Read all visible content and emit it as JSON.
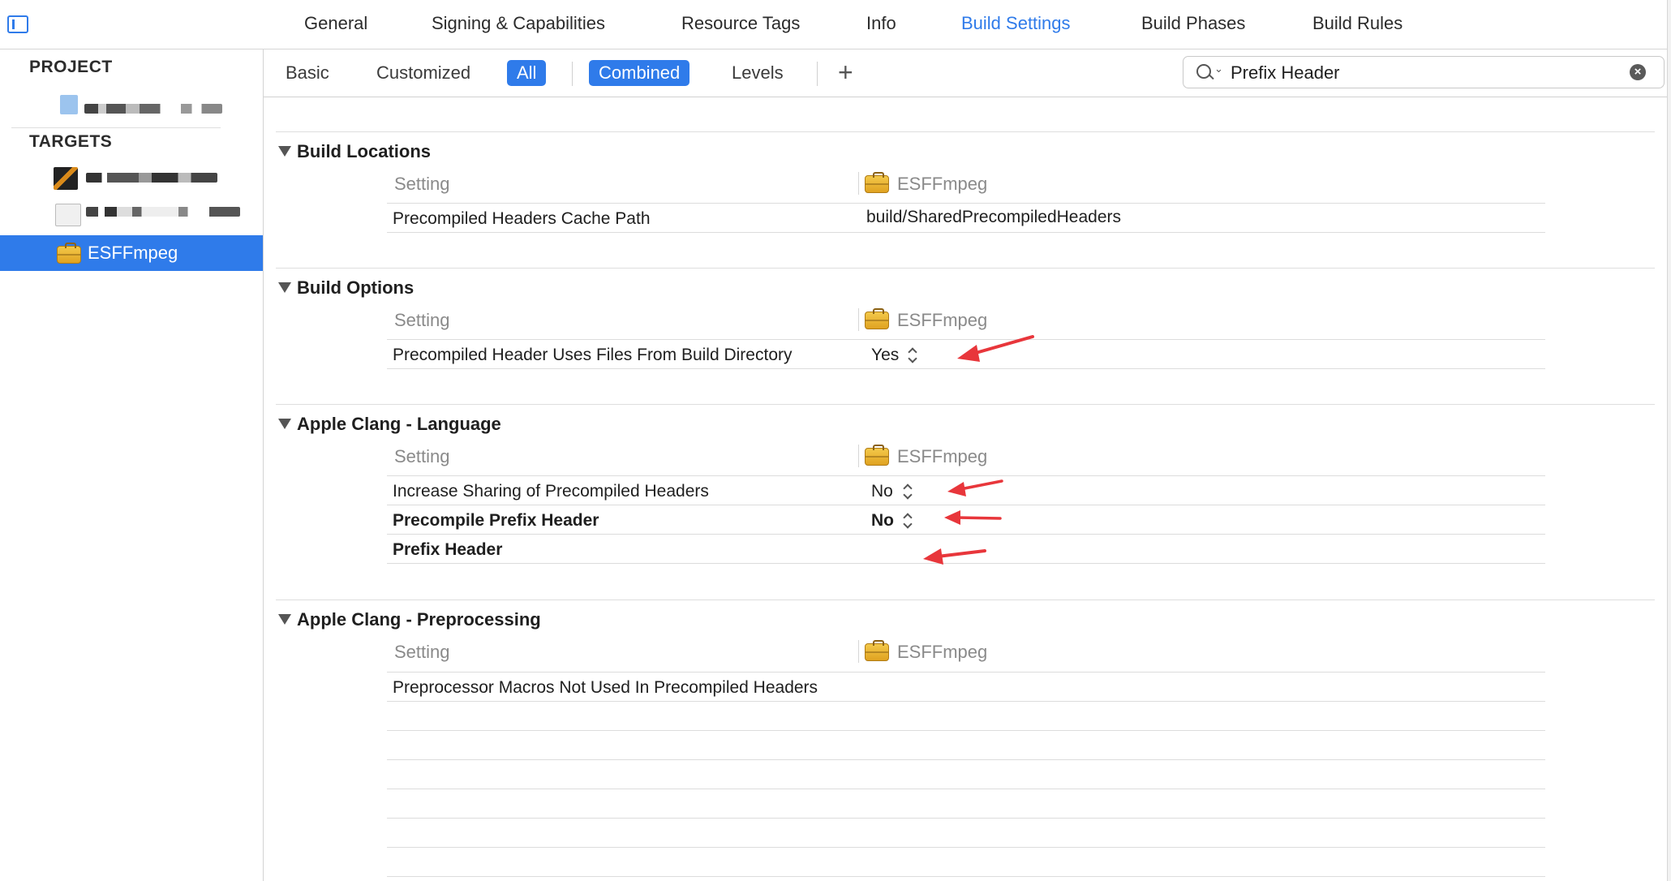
{
  "tabs": [
    {
      "label": "General",
      "active": false
    },
    {
      "label": "Signing & Capabilities",
      "active": false
    },
    {
      "label": "Resource Tags",
      "active": false
    },
    {
      "label": "Info",
      "active": false
    },
    {
      "label": "Build Settings",
      "active": true
    },
    {
      "label": "Build Phases",
      "active": false
    },
    {
      "label": "Build Rules",
      "active": false
    }
  ],
  "sidebar": {
    "project_header": "PROJECT",
    "targets_header": "TARGETS",
    "selected_target": "ESFFmpeg"
  },
  "filter": {
    "basic": "Basic",
    "customized": "Customized",
    "all": "All",
    "combined": "Combined",
    "levels": "Levels",
    "add": "+",
    "search_value": "Prefix Header"
  },
  "column_header": "Setting",
  "target_name": "ESFFmpeg",
  "sections": [
    {
      "title": "Build Locations",
      "rows": [
        {
          "name": "Precompiled Headers Cache Path",
          "value": "build/SharedPrecompiledHeaders",
          "bold": false,
          "stepper": false
        }
      ]
    },
    {
      "title": "Build Options",
      "rows": [
        {
          "name": "Precompiled Header Uses Files From Build Directory",
          "value": "Yes",
          "bold": false,
          "stepper": true
        }
      ]
    },
    {
      "title": "Apple Clang - Language",
      "rows": [
        {
          "name": "Increase Sharing of Precompiled Headers",
          "value": "No",
          "bold": false,
          "stepper": true
        },
        {
          "name": "Precompile Prefix Header",
          "value": "No",
          "bold": true,
          "stepper": true
        },
        {
          "name": "Prefix Header",
          "value": "",
          "bold": true,
          "stepper": false
        }
      ]
    },
    {
      "title": "Apple Clang - Preprocessing",
      "rows": [
        {
          "name": "Preprocessor Macros Not Used In Precompiled Headers",
          "value": "",
          "bold": false,
          "stepper": false
        }
      ]
    }
  ],
  "colors": {
    "accent": "#2f7bea",
    "annotation": "#e8363b"
  },
  "icons": {
    "target": "toolbox-icon",
    "search": "search-icon",
    "clear": "clear-icon",
    "disclosure": "disclosure-triangle-icon",
    "sidebar_toggle": "sidebar-toggle-icon"
  }
}
